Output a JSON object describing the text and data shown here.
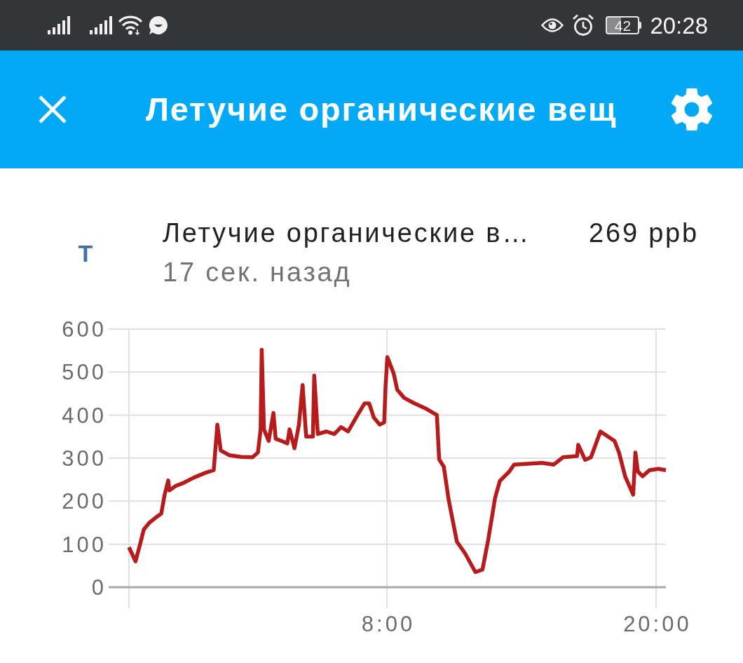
{
  "status_bar": {
    "battery": "42",
    "time": "20:28"
  },
  "header": {
    "title": "Летучие органические вещ"
  },
  "entity": {
    "icon_letter": "T",
    "name": "Летучие органические в…",
    "state": "269 ppb",
    "last_changed": "17 сек. назад"
  },
  "history": {
    "chart_data": {
      "type": "line",
      "grid": true,
      "x": [
        -3.5,
        -3.21,
        -3.0,
        -2.84,
        -2.59,
        -2.3,
        -2.06,
        -1.91,
        -1.75,
        -1.7,
        -1.4,
        -1.13,
        -0.6,
        -0.09,
        0.28,
        0.44,
        0.59,
        0.96,
        1.5,
        2.0,
        2.25,
        2.37,
        2.42,
        2.52,
        2.73,
        2.94,
        3.04,
        3.3,
        3.56,
        3.66,
        3.88,
        4.08,
        4.24,
        4.4,
        4.7,
        4.76,
        4.92,
        5.3,
        5.65,
        5.96,
        6.27,
        6.69,
        7.0,
        7.21,
        7.42,
        7.68,
        7.88,
        7.94,
        8.02,
        8.3,
        8.46,
        8.77,
        9.2,
        9.71,
        10.23,
        10.33,
        10.54,
        10.75,
        11.12,
        11.48,
        11.95,
        12.26,
        12.52,
        12.83,
        13.04,
        13.46,
        13.67,
        14.3,
        14.92,
        15.44,
        15.85,
        16.48,
        16.53,
        16.84,
        17.1,
        17.52,
        18.15,
        18.35,
        18.62,
        18.98,
        19.08,
        19.19,
        19.4,
        19.71,
        20.1,
        20.44
      ],
      "values": [
        93,
        60,
        101,
        134,
        150,
        162,
        171,
        215,
        248,
        225,
        236,
        241,
        255,
        266,
        272,
        378,
        318,
        307,
        303,
        302,
        313,
        367,
        552,
        367,
        340,
        405,
        345,
        340,
        334,
        367,
        323,
        378,
        470,
        350,
        350,
        492,
        356,
        362,
        356,
        372,
        362,
        400,
        427,
        427,
        394,
        378,
        383,
        465,
        535,
        497,
        459,
        440,
        428,
        416,
        400,
        297,
        280,
        204,
        106,
        79,
        35,
        41,
        111,
        209,
        247,
        269,
        285,
        287,
        289,
        285,
        302,
        305,
        331,
        296,
        302,
        362,
        340,
        313,
        258,
        215,
        313,
        269,
        258,
        272,
        275,
        272
      ],
      "xlim": [
        -3.5,
        20.44
      ],
      "ylim": [
        0,
        600
      ],
      "xticks": [
        {
          "value": 8,
          "label": "8:00"
        },
        {
          "value": 20,
          "label": "20:00"
        }
      ],
      "yticks": [
        0,
        100,
        200,
        300,
        400,
        500,
        600
      ]
    }
  }
}
